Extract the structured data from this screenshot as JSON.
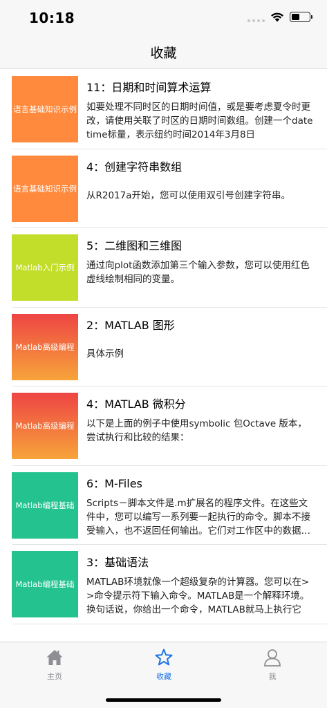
{
  "status_bar": {
    "time": "10:18"
  },
  "nav": {
    "title": "收藏"
  },
  "items": [
    {
      "thumb_label": "语言基础知识示例",
      "thumb_colors": [
        "#ff8a3d",
        "#ff8a3d"
      ],
      "title": "11：日期和时间算术运算",
      "desc": "如要处理不同时区的日期时间值，或是要考虑夏令时更改，请使用关联了时区的日期时间数组。创建一个datetime标量，表示纽约时间2014年3月8日",
      "single": false
    },
    {
      "thumb_label": "语言基础知识示例",
      "thumb_colors": [
        "#ff8a3d",
        "#ff8a3d"
      ],
      "title": "4：创建字符串数组",
      "desc": "从R2017a开始，您可以使用双引号创建字符串。",
      "single": true
    },
    {
      "thumb_label": "Matlab入门示例",
      "thumb_colors": [
        "#c2dd2a",
        "#c2dd2a"
      ],
      "title": "5：二维图和三维图",
      "desc": "通过向plot函数添加第三个输入参数，您可以使用红色虚线绘制相同的变量。",
      "single": false
    },
    {
      "thumb_label": "Matlab高级编程",
      "thumb_colors": [
        "#ee4444",
        "#f7a43a"
      ],
      "title": "2：MATLAB 图形",
      "desc": "具体示例",
      "single": true
    },
    {
      "thumb_label": "Matlab高级编程",
      "thumb_colors": [
        "#ee4444",
        "#f7a43a"
      ],
      "title": "4：MATLAB 微积分",
      "desc": "以下是上面的例子中使用symbolic 包Octave 版本，尝试执行和比较的结果：",
      "single": false
    },
    {
      "thumb_label": "Matlab编程基础",
      "thumb_colors": [
        "#23c28e",
        "#23c28e"
      ],
      "title": "6：M-Files",
      "desc": "Scripts－脚本文件是.m扩展名的程序文件。在这些文件中，您可以编写一系列要一起执行的命令。脚本不接受输入，也不返回任何输出。它们对工作区中的数据进行操作",
      "single": false
    },
    {
      "thumb_label": "Matlab编程基础",
      "thumb_colors": [
        "#23c28e",
        "#23c28e"
      ],
      "title": "3：基础语法",
      "desc": "MATLAB环境就像一个超级复杂的计算器。您可以在>>命令提示符下输入命令。MATLAB是一个解释环境。换句话说，你给出一个命令，MATLAB就马上执行它",
      "single": false
    }
  ],
  "tabs": [
    {
      "label": "主页",
      "icon": "home-icon",
      "active": false
    },
    {
      "label": "收藏",
      "icon": "star-icon",
      "active": true
    },
    {
      "label": "我",
      "icon": "person-icon",
      "active": false
    }
  ],
  "colors": {
    "accent": "#1a73e8",
    "inactive": "#8e8e93"
  }
}
